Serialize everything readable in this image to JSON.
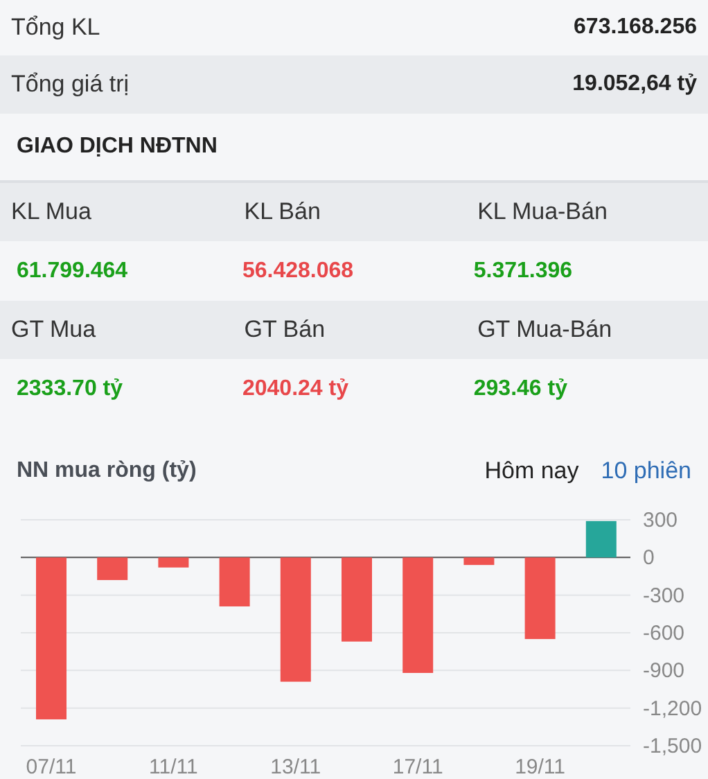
{
  "summary": [
    {
      "label": "Tổng KL",
      "value": "673.168.256"
    },
    {
      "label": "Tổng giá trị",
      "value": "19.052,64 tỷ"
    }
  ],
  "section_title": "GIAO DỊCH NĐTNN",
  "foreign_trading": [
    {
      "columns": [
        {
          "label": "KL Mua",
          "value": "61.799.464",
          "color": "#1aa01a"
        },
        {
          "label": "KL Bán",
          "value": "56.428.068",
          "color": "#e8474a"
        },
        {
          "label": "KL Mua-Bán",
          "value": "5.371.396",
          "color": "#1aa01a"
        }
      ]
    },
    {
      "columns": [
        {
          "label": "GT Mua",
          "value": "2333.70 tỷ",
          "color": "#1aa01a"
        },
        {
          "label": "GT Bán",
          "value": "2040.24 tỷ",
          "color": "#e8474a"
        },
        {
          "label": "GT Mua-Bán",
          "value": "293.46 tỷ",
          "color": "#1aa01a"
        }
      ]
    }
  ],
  "chart_panel": {
    "title": "NN mua ròng (tỷ)",
    "tabs": [
      {
        "label": "Hôm nay",
        "selected": false
      },
      {
        "label": "10 phiên",
        "selected": true
      }
    ],
    "chart_data": {
      "type": "bar",
      "categories": [
        "07/11",
        null,
        "11/11",
        null,
        "13/11",
        null,
        "17/11",
        null,
        "19/11",
        null
      ],
      "series": [
        {
          "values": [
            -1290,
            -180,
            -80,
            -390,
            -990,
            -670,
            -920,
            -60,
            -650,
            290
          ]
        }
      ],
      "grid": true,
      "ylim": [
        -1500,
        300
      ],
      "yticks": [
        {
          "value": 300,
          "label": "300"
        },
        {
          "value": 0,
          "label": "0"
        },
        {
          "value": -300,
          "label": "-300"
        },
        {
          "value": -600,
          "label": "-600"
        },
        {
          "value": -900,
          "label": "-900"
        },
        {
          "value": -1200,
          "label": "-1,200"
        },
        {
          "value": -1500,
          "label": "-1,500"
        }
      ]
    }
  }
}
